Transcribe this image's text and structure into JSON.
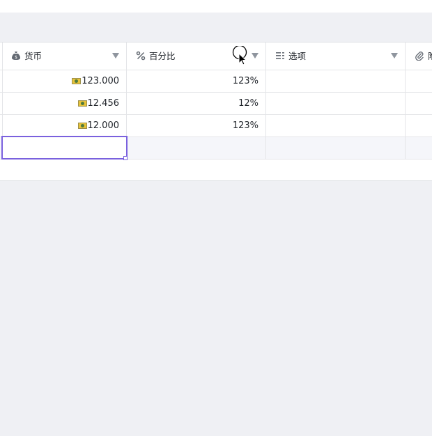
{
  "columns": [
    {
      "title": "货币",
      "icon": "money-bag-icon"
    },
    {
      "title": "百分比",
      "icon": "percent-icon"
    },
    {
      "title": "选项",
      "icon": "options-list-icon"
    },
    {
      "title": "附",
      "icon": "paperclip-icon"
    }
  ],
  "rows": [
    {
      "currency": "123.000",
      "percent": "123%",
      "option": "",
      "attachment": ""
    },
    {
      "currency": "12.456",
      "percent": "12%",
      "option": "",
      "attachment": ""
    },
    {
      "currency": "12.000",
      "percent": "123%",
      "option": "",
      "attachment": ""
    }
  ],
  "colors": {
    "selection": "#7a61de",
    "background": "#eff0f4"
  }
}
